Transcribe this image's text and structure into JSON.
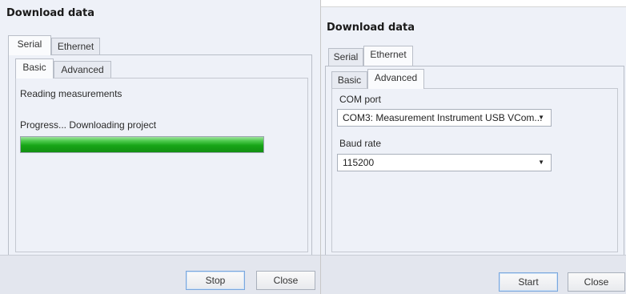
{
  "left": {
    "title": "Download data",
    "tabs_outer": [
      "Serial",
      "Ethernet"
    ],
    "tabs_inner": [
      "Basic",
      "Advanced"
    ],
    "status_text": "Reading measurements",
    "progress_text": "Progress... Downloading project",
    "progress_fraction": 1.0,
    "buttons": {
      "stop": "Stop",
      "close": "Close"
    }
  },
  "right": {
    "title": "Download data",
    "tabs_outer": [
      "Serial",
      "Ethernet"
    ],
    "tabs_inner": [
      "Basic",
      "Advanced"
    ],
    "com_port_label": "COM port",
    "com_port_value": "COM3: Measurement Instrument USB VCom...",
    "baud_rate_label": "Baud rate",
    "baud_rate_value": "115200",
    "buttons": {
      "start": "Start",
      "close": "Close"
    }
  },
  "icons": {
    "dropdown": "chevron-down-icon"
  }
}
